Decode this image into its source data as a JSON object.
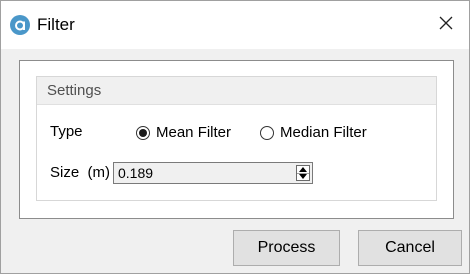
{
  "window": {
    "title": "Filter",
    "icon": "app-logo-icon",
    "close_icon": "close-icon"
  },
  "settings": {
    "group_title": "Settings",
    "type": {
      "label": "Type",
      "options": [
        {
          "label": "Mean Filter",
          "selected": true
        },
        {
          "label": "Median Filter",
          "selected": false
        }
      ]
    },
    "size": {
      "label": "Size  (m)",
      "value": "0.189"
    }
  },
  "buttons": {
    "process": "Process",
    "cancel": "Cancel"
  },
  "colors": {
    "icon_accent": "#4a97c9",
    "dialog_background": "#f0f0f0",
    "button_background": "#e1e1e1"
  }
}
